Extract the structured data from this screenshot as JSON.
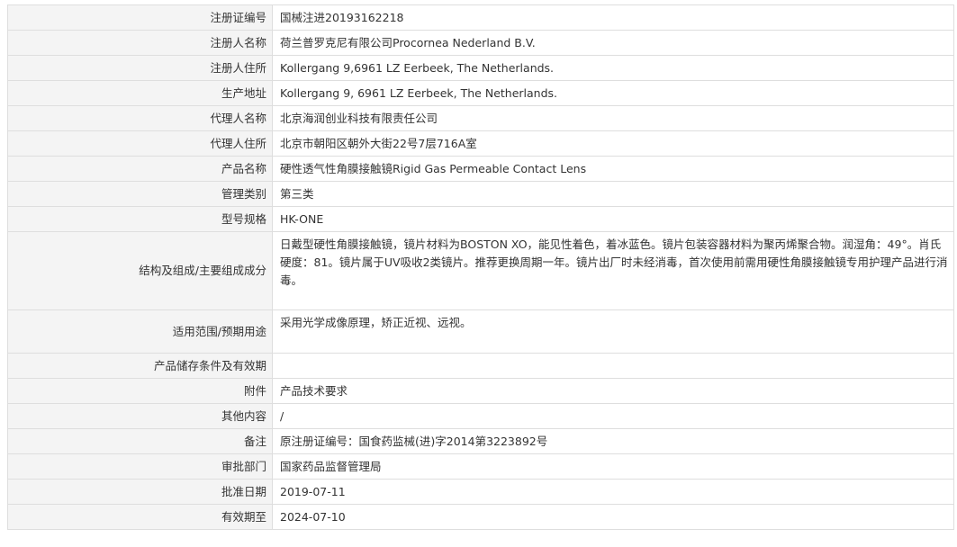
{
  "rows": [
    {
      "label": "注册证编号",
      "value": "国械注进20193162218"
    },
    {
      "label": "注册人名称",
      "value": "荷兰普罗克尼有限公司Procornea Nederland B.V."
    },
    {
      "label": "注册人住所",
      "value": "Kollergang 9,6961 LZ Eerbeek, The Netherlands."
    },
    {
      "label": "生产地址",
      "value": "Kollergang 9, 6961 LZ Eerbeek, The Netherlands."
    },
    {
      "label": "代理人名称",
      "value": "北京海润创业科技有限责任公司"
    },
    {
      "label": "代理人住所",
      "value": "北京市朝阳区朝外大街22号7层716A室"
    },
    {
      "label": "产品名称",
      "value": "硬性透气性角膜接触镜Rigid Gas Permeable Contact Lens"
    },
    {
      "label": "管理类别",
      "value": "第三类"
    },
    {
      "label": "型号规格",
      "value": "HK-ONE"
    },
    {
      "label": "结构及组成/主要组成成分",
      "value": "日戴型硬性角膜接触镜，镜片材料为BOSTON XO，能见性着色，着冰蓝色。镜片包装容器材料为聚丙烯聚合物。润湿角：49°。肖氏硬度：81。镜片属于UV吸收2类镜片。推荐更换周期一年。镜片出厂时未经消毒，首次使用前需用硬性角膜接触镜专用护理产品进行消毒。"
    },
    {
      "label": "适用范围/预期用途",
      "value": "采用光学成像原理，矫正近视、远视。"
    },
    {
      "label": "产品储存条件及有效期",
      "value": ""
    },
    {
      "label": "附件",
      "value": "产品技术要求"
    },
    {
      "label": "其他内容",
      "value": "/"
    },
    {
      "label": "备注",
      "value": "原注册证编号：国食药监械(进)字2014第3223892号"
    },
    {
      "label": "审批部门",
      "value": "国家药品监督管理局"
    },
    {
      "label": "批准日期",
      "value": "2019-07-11"
    },
    {
      "label": "有效期至",
      "value": "2024-07-10"
    }
  ]
}
